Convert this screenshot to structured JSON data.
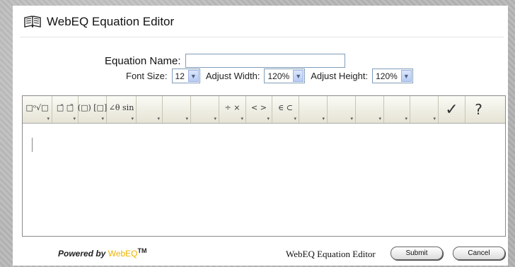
{
  "header": {
    "title": "WebEQ Equation Editor",
    "icon": "book-icon"
  },
  "form": {
    "equation_name_label": "Equation Name:",
    "equation_name_value": "",
    "font_size_label": "Font Size:",
    "font_size_value": "12",
    "adjust_width_label": "Adjust Width:",
    "adjust_width_value": "120%",
    "adjust_height_label": "Adjust Height:",
    "adjust_height_value": "120%"
  },
  "toolbar": {
    "buttons": [
      {
        "name": "roots-palette",
        "glyph": "□ᵒ√□"
      },
      {
        "name": "accents-palette",
        "glyph": "□̄ □̃"
      },
      {
        "name": "fences-palette",
        "glyph": "(□) [□]"
      },
      {
        "name": "functions-palette",
        "glyph": "∠θ sin"
      },
      {
        "name": "blank-palette-1",
        "glyph": ""
      },
      {
        "name": "blank-palette-2",
        "glyph": ""
      },
      {
        "name": "blank-palette-3",
        "glyph": ""
      },
      {
        "name": "operators-palette",
        "glyph": "÷ ×"
      },
      {
        "name": "relations-palette",
        "glyph": "< >"
      },
      {
        "name": "sets-palette",
        "glyph": "∈ ⊂"
      },
      {
        "name": "blank-palette-4",
        "glyph": ""
      },
      {
        "name": "blank-palette-5",
        "glyph": ""
      },
      {
        "name": "blank-palette-6",
        "glyph": ""
      },
      {
        "name": "blank-palette-7",
        "glyph": ""
      },
      {
        "name": "blank-palette-8",
        "glyph": ""
      }
    ],
    "check_glyph": "✓",
    "help_glyph": "?"
  },
  "footer": {
    "powered_by": "Powered by",
    "powered_brand": "WebEQ",
    "trademark": "TM",
    "label": "WebEQ Equation Editor",
    "submit_label": "Submit",
    "cancel_label": "Cancel"
  }
}
